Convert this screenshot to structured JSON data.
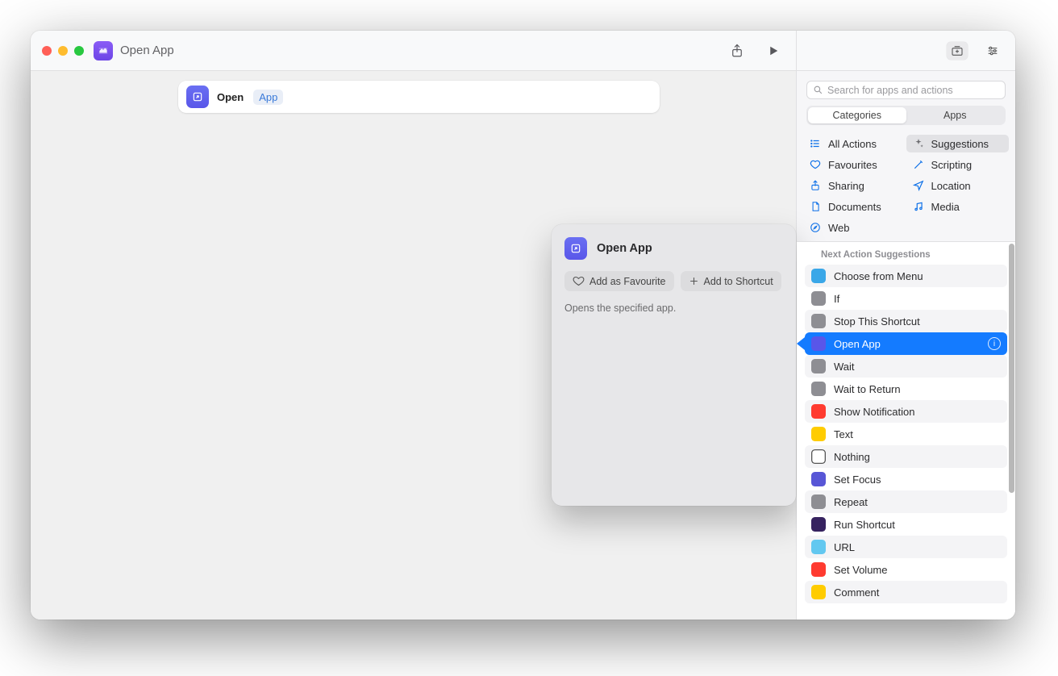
{
  "window": {
    "title": "Open App"
  },
  "block": {
    "label": "Open",
    "param_token": "App"
  },
  "popover": {
    "title": "Open App",
    "fav_label": "Add as Favourite",
    "add_label": "Add to Shortcut",
    "description": "Opens the specified app."
  },
  "sidebar": {
    "search_placeholder": "Search for apps and actions",
    "seg": {
      "left": "Categories",
      "right": "Apps"
    },
    "categories": {
      "all": "All Actions",
      "suggestions": "Suggestions",
      "favourites": "Favourites",
      "scripting": "Scripting",
      "sharing": "Sharing",
      "location": "Location",
      "documents": "Documents",
      "media": "Media",
      "web": "Web"
    },
    "list_heading": "Next Action Suggestions",
    "actions": [
      {
        "label": "Choose from Menu",
        "color": "#3aa7e8"
      },
      {
        "label": "If",
        "color": "#8e8e93"
      },
      {
        "label": "Stop This Shortcut",
        "color": "#8e8e93"
      },
      {
        "label": "Open App",
        "color": "#5956e9",
        "selected": true
      },
      {
        "label": "Wait",
        "color": "#8e8e93"
      },
      {
        "label": "Wait to Return",
        "color": "#8e8e93"
      },
      {
        "label": "Show Notification",
        "color": "#ff3b30"
      },
      {
        "label": "Text",
        "color": "#ffcc00"
      },
      {
        "label": "Nothing",
        "color": "#ffffff",
        "border": true
      },
      {
        "label": "Set Focus",
        "color": "#5856d6"
      },
      {
        "label": "Repeat",
        "color": "#8e8e93"
      },
      {
        "label": "Run Shortcut",
        "color": "#36225f"
      },
      {
        "label": "URL",
        "color": "#63c8f0"
      },
      {
        "label": "Set Volume",
        "color": "#ff3b30"
      },
      {
        "label": "Comment",
        "color": "#ffcc00"
      }
    ]
  }
}
